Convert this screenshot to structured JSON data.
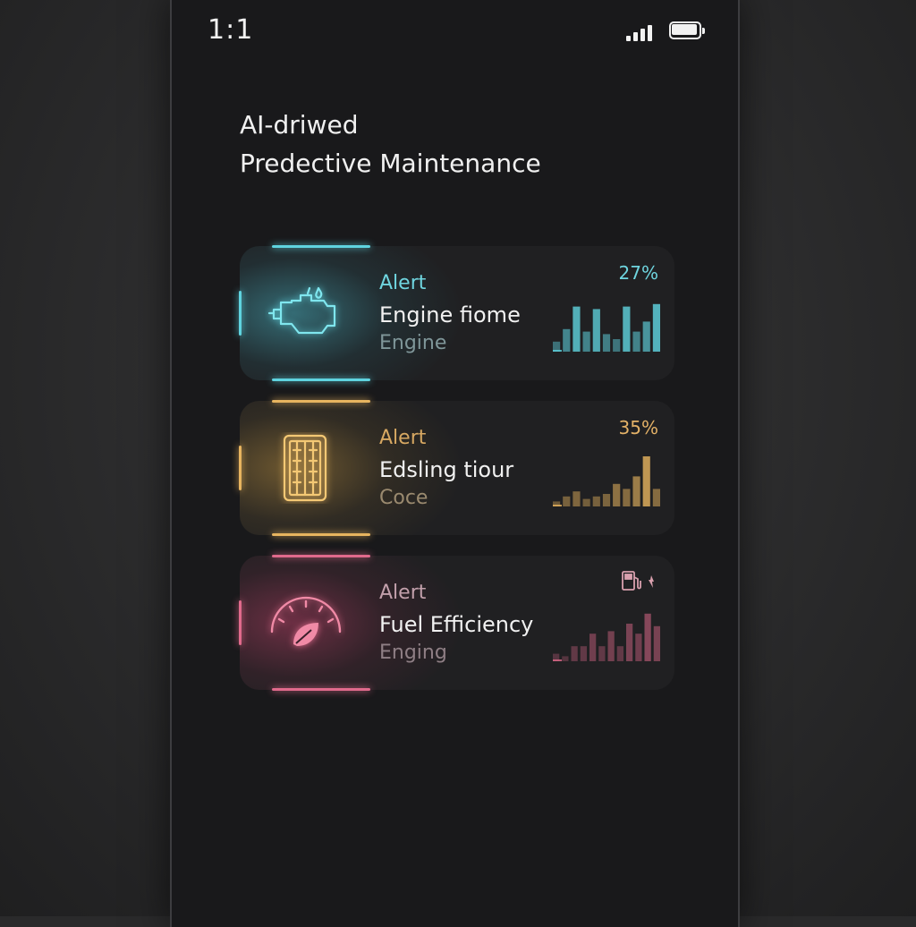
{
  "status_bar": {
    "time": "1:1",
    "signal_bars": 4,
    "battery_level": 0.9
  },
  "header": {
    "title_line1": "AI-driwed",
    "title_line2": "Predective Maintenance"
  },
  "alerts": [
    {
      "alert_label": "Alert",
      "title": "Engine fiome",
      "subtitle": "Engine",
      "percent": "27%",
      "accent": "#5fd3df",
      "icon": "engine-icon",
      "bars": [
        0.2,
        0.45,
        0.9,
        0.4,
        0.85,
        0.35,
        0.25,
        0.9,
        0.4,
        0.6,
        0.95
      ]
    },
    {
      "alert_label": "Alert",
      "title": "Edsling tiour",
      "subtitle": "Coce",
      "percent": "35%",
      "accent": "#e7b45f",
      "icon": "battery-pack-icon",
      "bars": [
        0.1,
        0.2,
        0.3,
        0.15,
        0.2,
        0.25,
        0.45,
        0.35,
        0.6,
        1.0,
        0.35
      ]
    },
    {
      "alert_label": "Alert",
      "title": "Fuel Efficiency",
      "subtitle": "Enging",
      "percent": "",
      "accent": "#e06a8c",
      "icon": "gauge-leaf-icon",
      "corner_icon": "fuel-pump-icon",
      "bars": [
        0.15,
        0.1,
        0.3,
        0.3,
        0.55,
        0.3,
        0.6,
        0.3,
        0.75,
        0.55,
        0.95,
        0.7
      ]
    }
  ]
}
